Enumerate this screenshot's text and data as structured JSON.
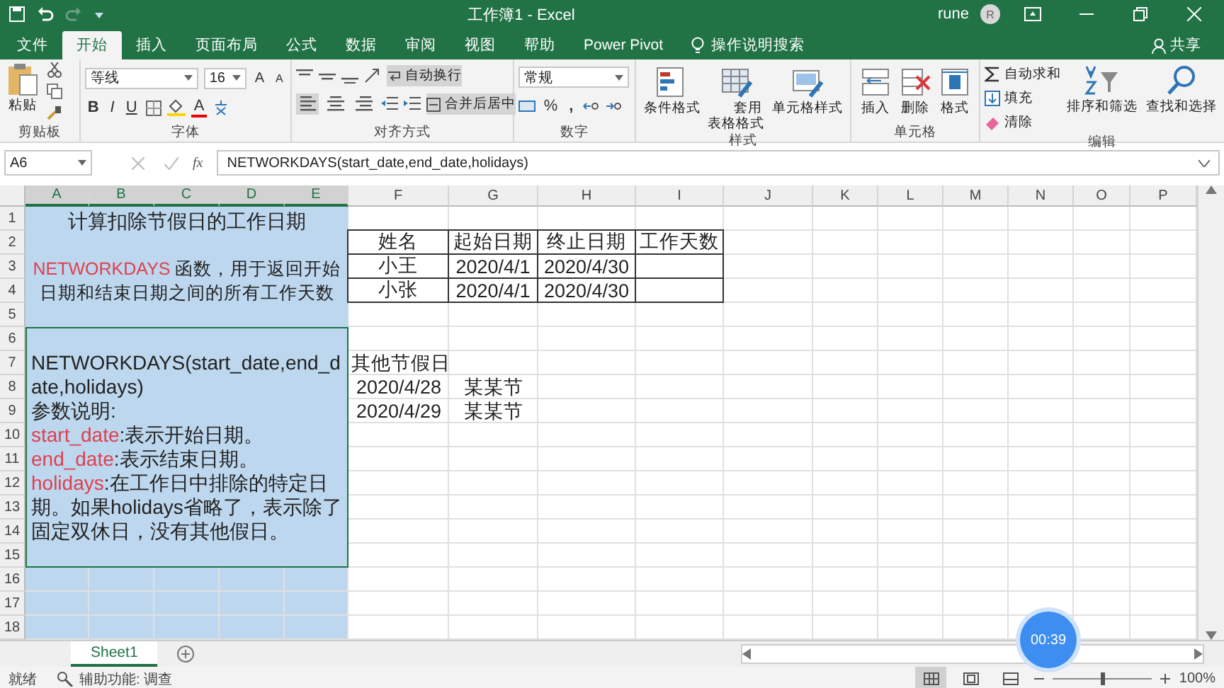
{
  "title_bar": {
    "title": "工作簿1 - Excel",
    "user": "rune",
    "avatar_initial": "R"
  },
  "menu_tabs": [
    {
      "label": "文件",
      "selected": false
    },
    {
      "label": "开始",
      "selected": true
    },
    {
      "label": "插入",
      "selected": false
    },
    {
      "label": "页面布局",
      "selected": false
    },
    {
      "label": "公式",
      "selected": false
    },
    {
      "label": "数据",
      "selected": false
    },
    {
      "label": "审阅",
      "selected": false
    },
    {
      "label": "视图",
      "selected": false
    },
    {
      "label": "帮助",
      "selected": false
    },
    {
      "label": "Power Pivot",
      "selected": false
    }
  ],
  "tell_me": "操作说明搜索",
  "share": "共享",
  "ribbon": {
    "clipboard": {
      "label": "剪贴板",
      "paste": "粘贴"
    },
    "font": {
      "label": "字体",
      "font_name": "等线",
      "font_size": "16",
      "grow": "A",
      "shrink": "A",
      "bold": "B",
      "italic": "I",
      "underline": "U",
      "font_color": "A"
    },
    "alignment": {
      "label": "对齐方式",
      "wrap_text": {
        "label": "自动换行",
        "active": true
      },
      "merge": {
        "label": "合并后居中",
        "active": true
      },
      "horizontal_align": [
        {
          "kind": "left",
          "selected": true
        },
        {
          "kind": "center",
          "selected": false
        },
        {
          "kind": "right",
          "selected": false
        }
      ]
    },
    "number": {
      "label": "数字",
      "format": "常规",
      "percent": "%",
      "comma": ","
    },
    "styles": {
      "label": "样式",
      "buttons": [
        {
          "kind": "conditional",
          "label": "条件格式"
        },
        {
          "kind": "table",
          "label": "套用表格格式"
        },
        {
          "kind": "cell",
          "label": "单元格样式"
        }
      ]
    },
    "cells": {
      "label": "单元格",
      "buttons": [
        {
          "kind": "insert",
          "label": "插入"
        },
        {
          "kind": "delete",
          "label": "删除"
        },
        {
          "kind": "format",
          "label": "格式"
        }
      ]
    },
    "editing": {
      "label": "编辑",
      "small": [
        {
          "kind": "sum",
          "label": "自动求和"
        },
        {
          "kind": "fill",
          "label": "填充"
        },
        {
          "kind": "clear",
          "label": "清除"
        }
      ],
      "big": [
        {
          "kind": "sort",
          "label": "排序和筛选"
        },
        {
          "kind": "find",
          "label": "查找和选择"
        }
      ]
    }
  },
  "formula_bar": {
    "name_box": "A6",
    "function_label": "fx",
    "formula": "NETWORKDAYS(start_date,end_date,holidays)"
  },
  "columns": [
    {
      "label": "A",
      "selected": true
    },
    {
      "label": "B",
      "selected": true
    },
    {
      "label": "C",
      "selected": true
    },
    {
      "label": "D",
      "selected": true
    },
    {
      "label": "E",
      "selected": true
    },
    {
      "label": "F",
      "selected": false
    },
    {
      "label": "G",
      "selected": false
    },
    {
      "label": "H",
      "selected": false
    },
    {
      "label": "I",
      "selected": false
    },
    {
      "label": "J",
      "selected": false
    },
    {
      "label": "K",
      "selected": false
    },
    {
      "label": "L",
      "selected": false
    },
    {
      "label": "M",
      "selected": false
    },
    {
      "label": "N",
      "selected": false
    },
    {
      "label": "O",
      "selected": false
    },
    {
      "label": "P",
      "selected": false
    }
  ],
  "rows": [
    "1",
    "2",
    "3",
    "4",
    "5",
    "6",
    "7",
    "8",
    "9",
    "10",
    "11",
    "12",
    "13",
    "14",
    "15",
    "16",
    "17",
    "18"
  ],
  "title_block": {
    "heading": "计算扣除节假日的工作日期",
    "keyword": "NETWORKDAYS",
    "description": " 函数，用于返回开始日期和结束日期之间的所有工作天数"
  },
  "syntax_block": {
    "syntax": "NETWORKDAYS(start_date,end_date,holidays)",
    "params_heading": "参数说明:",
    "params": [
      {
        "name": "start_date",
        "text": ":表示开始日期。"
      },
      {
        "name": "end_date",
        "text": ":表示结束日期。"
      },
      {
        "name": "holidays",
        "text": ":在工作日中排除的特定日期。如果holidays省略了，表示除了固定双休日，没有其他假日。"
      }
    ]
  },
  "employee_table": {
    "columns": [
      "姓名",
      "起始日期",
      "终止日期",
      "工作天数"
    ],
    "rows": [
      [
        "小王",
        "2020/4/1",
        "2020/4/30"
      ],
      [
        "小张",
        "2020/4/1",
        "2020/4/30"
      ]
    ]
  },
  "holidays": {
    "heading": "其他节假日",
    "rows": [
      [
        "2020/4/28",
        "某某节"
      ],
      [
        "2020/4/29",
        "某某节"
      ]
    ]
  },
  "sheet_tabs": [
    {
      "label": "Sheet1",
      "selected": true
    }
  ],
  "status_bar": {
    "status": "就绪",
    "accessibility": "辅助功能: 调查",
    "zoom": "100%",
    "zoom_slider": {
      "level": 0.5
    }
  },
  "timer": "00:39"
}
